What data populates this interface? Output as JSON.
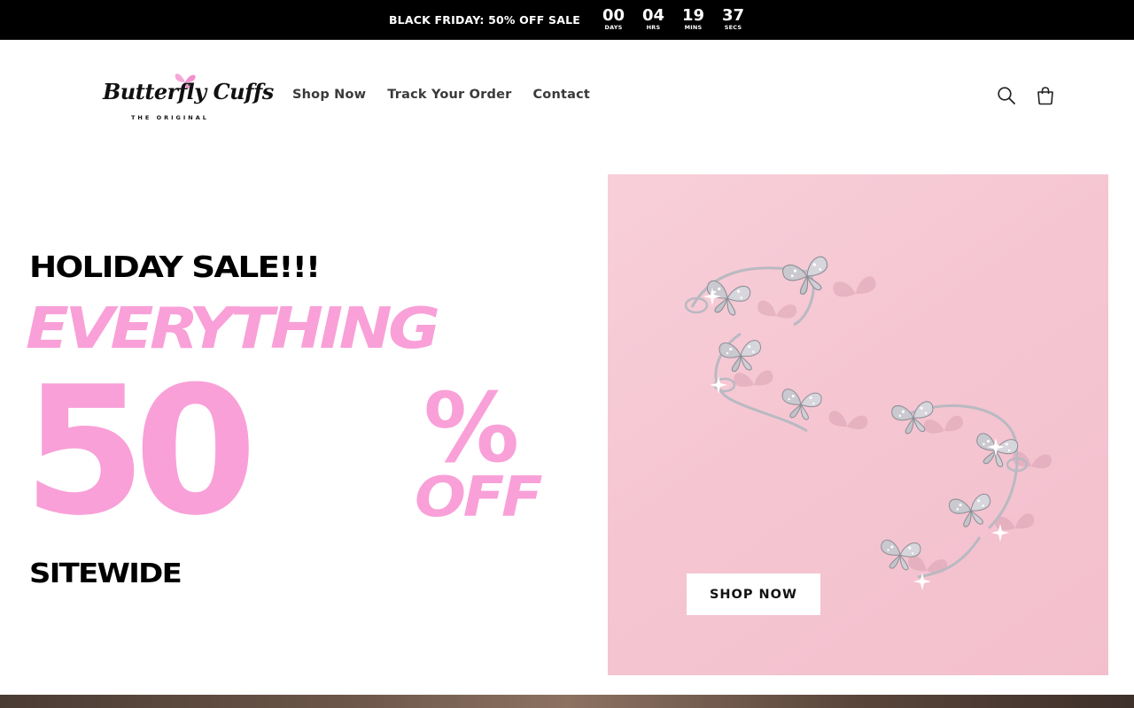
{
  "announcement": {
    "text": "BLACK FRIDAY: 50% OFF SALE",
    "countdown": [
      {
        "value": "00",
        "label": "DAYS"
      },
      {
        "value": "04",
        "label": "HRS"
      },
      {
        "value": "19",
        "label": "MINS"
      },
      {
        "value": "37",
        "label": "SECS"
      }
    ]
  },
  "brand": {
    "name": "Butterfly Cuffs",
    "tagline": "THE ORIGINAL",
    "accent": "#f7a8d8"
  },
  "nav": {
    "links": [
      "Shop Now",
      "Track Your Order",
      "Contact"
    ]
  },
  "header_icons": [
    "search-icon",
    "cart-icon"
  ],
  "hero": {
    "line1": "HOLIDAY SALE!!!",
    "line2": "EVERYTHING",
    "big": "50",
    "percent": "%",
    "off": "OFF",
    "line4": "SITEWIDE",
    "cta": "SHOP NOW",
    "pink": "#f9a0d8",
    "image_bg": "#f5c6d2"
  }
}
